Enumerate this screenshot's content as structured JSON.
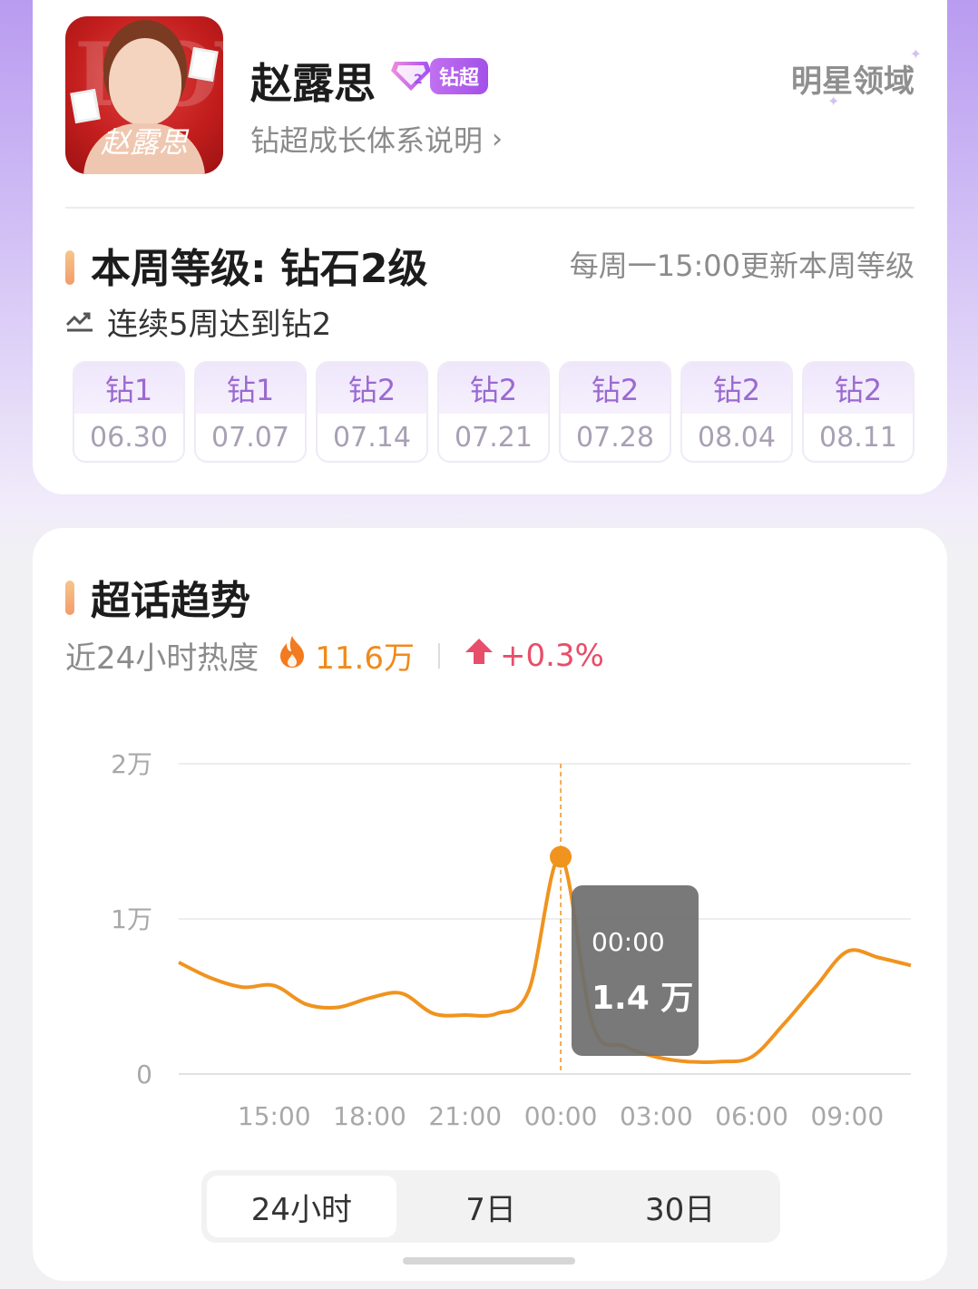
{
  "profile": {
    "name": "赵露思",
    "avatar_signature": "赵露思",
    "badge_label": "钻超",
    "growth_link": "钻超成长体系说明",
    "brand": "明星领域"
  },
  "level": {
    "title": "本周等级: 钻石2级",
    "update_note": "每周一15:00更新本周等级",
    "streak": "连续5周达到钻2",
    "weeks": [
      {
        "level": "钻1",
        "date": "06.30"
      },
      {
        "level": "钻1",
        "date": "07.07"
      },
      {
        "level": "钻2",
        "date": "07.14"
      },
      {
        "level": "钻2",
        "date": "07.21"
      },
      {
        "level": "钻2",
        "date": "07.28"
      },
      {
        "level": "钻2",
        "date": "08.04"
      },
      {
        "level": "钻2",
        "date": "08.11"
      }
    ]
  },
  "trend": {
    "title": "超话趋势",
    "heat_label": "近24小时热度",
    "heat_value": "11.6万",
    "change": "+0.3%",
    "tooltip_time": "00:00",
    "tooltip_value": "1.4 万",
    "tabs": [
      "24小时",
      "7日",
      "30日"
    ],
    "active_tab": "24小时"
  },
  "colors": {
    "accent_orange": "#f08a1a",
    "line": "#f0931f",
    "up_red": "#e84d6a",
    "level_purple": "#9a6ad0"
  },
  "chart_data": {
    "type": "line",
    "y_tick_labels": [
      "0",
      "1万",
      "2万"
    ],
    "x_tick_labels": [
      "15:00",
      "18:00",
      "21:00",
      "00:00",
      "03:00",
      "06:00",
      "09:00"
    ],
    "ylim": [
      0,
      20000
    ],
    "grid": true,
    "x": [
      "12:00",
      "13:00",
      "14:00",
      "15:00",
      "16:00",
      "17:00",
      "18:00",
      "19:00",
      "20:00",
      "21:00",
      "22:00",
      "23:00",
      "00:00",
      "01:00",
      "02:00",
      "03:00",
      "04:00",
      "05:00",
      "06:00",
      "07:00",
      "08:00",
      "09:00",
      "10:00",
      "11:00"
    ],
    "series": [
      {
        "values": [
          7200,
          6200,
          5600,
          5700,
          4500,
          4300,
          4900,
          5200,
          3900,
          3800,
          3900,
          5400,
          14000,
          3200,
          1800,
          1100,
          800,
          800,
          1100,
          3200,
          5600,
          7900,
          7500,
          7000
        ]
      }
    ],
    "highlight": {
      "x": "00:00",
      "value": 14000
    }
  }
}
